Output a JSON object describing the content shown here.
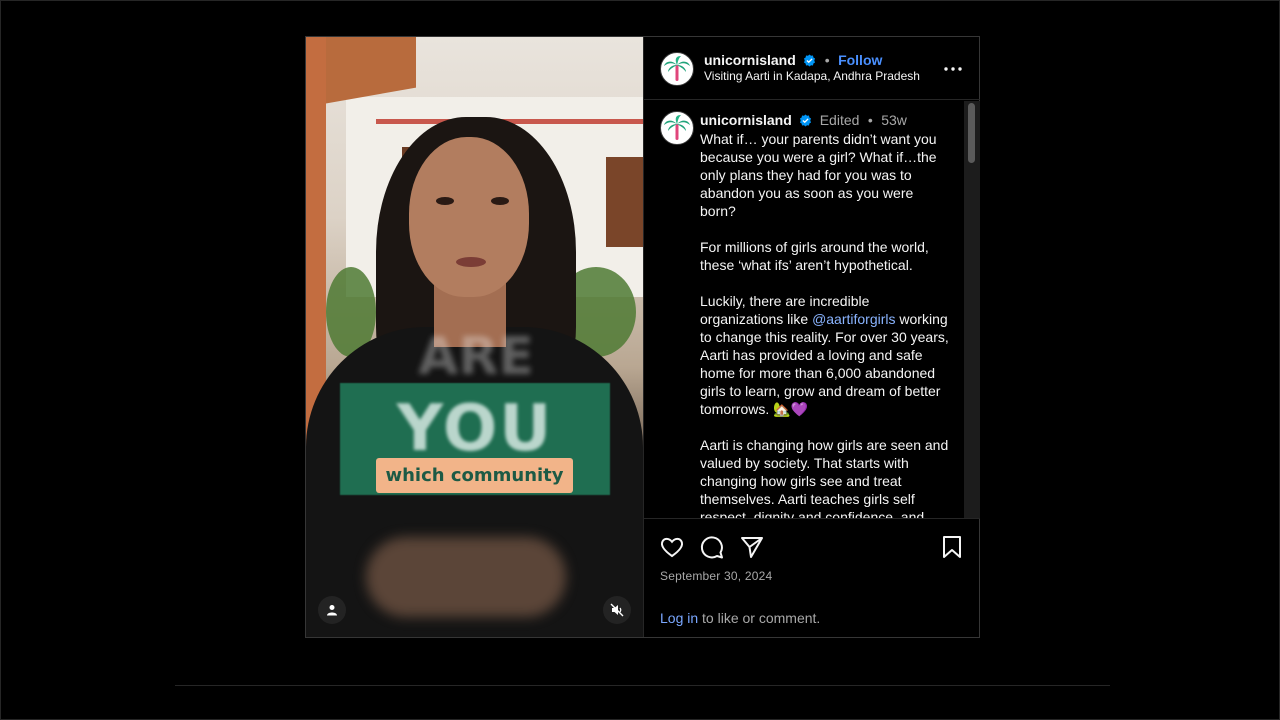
{
  "post": {
    "username": "unicornisland",
    "follow_label": "Follow",
    "location": "Visiting Aarti in Kadapa, Andhra Pradesh",
    "header_separator": "•"
  },
  "video": {
    "overlay_big_text": "YOU",
    "overlay_ghost_text": "ARE",
    "overlay_caption": "which community"
  },
  "caption": {
    "username": "unicornisland",
    "edited_label": "Edited",
    "separator": "•",
    "age": "53w",
    "text_part1": "What if… your parents didn’t want you because you were a girl? What if…the only plans they had for you was to abandon you as soon as you were born?\n\nFor millions of girls around the world, these ‘what ifs’ aren’t hypothetical.\n\nLuckily, there are incredible organizations like ",
    "mention": "@aartiforgirls",
    "text_part2": " working to change this reality. For over 30 years, Aarti has provided a loving and safe home for more than 6,000 abandoned girls to learn, grow and dream of better tomorrows. 🏡💜\n\nAarti is changing how girls are seen and valued by society. That starts with changing how girls see and treat themselves. Aarti teaches girls self respect, dignity and confidence, and"
  },
  "footer": {
    "date": "September 30, 2024",
    "login_link": "Log in",
    "login_rest": " to like or comment."
  },
  "colors": {
    "background": "#000000",
    "link_blue": "#4a90ff",
    "verified_blue": "#0095f6",
    "banner_green": "#207858",
    "pill_peach": "#f2b489"
  },
  "icons": [
    "palm-tree-avatar-icon",
    "verified-badge-icon",
    "more-options-icon",
    "heart-icon",
    "comment-icon",
    "share-icon",
    "bookmark-icon",
    "user-tag-icon",
    "muted-speaker-icon"
  ]
}
